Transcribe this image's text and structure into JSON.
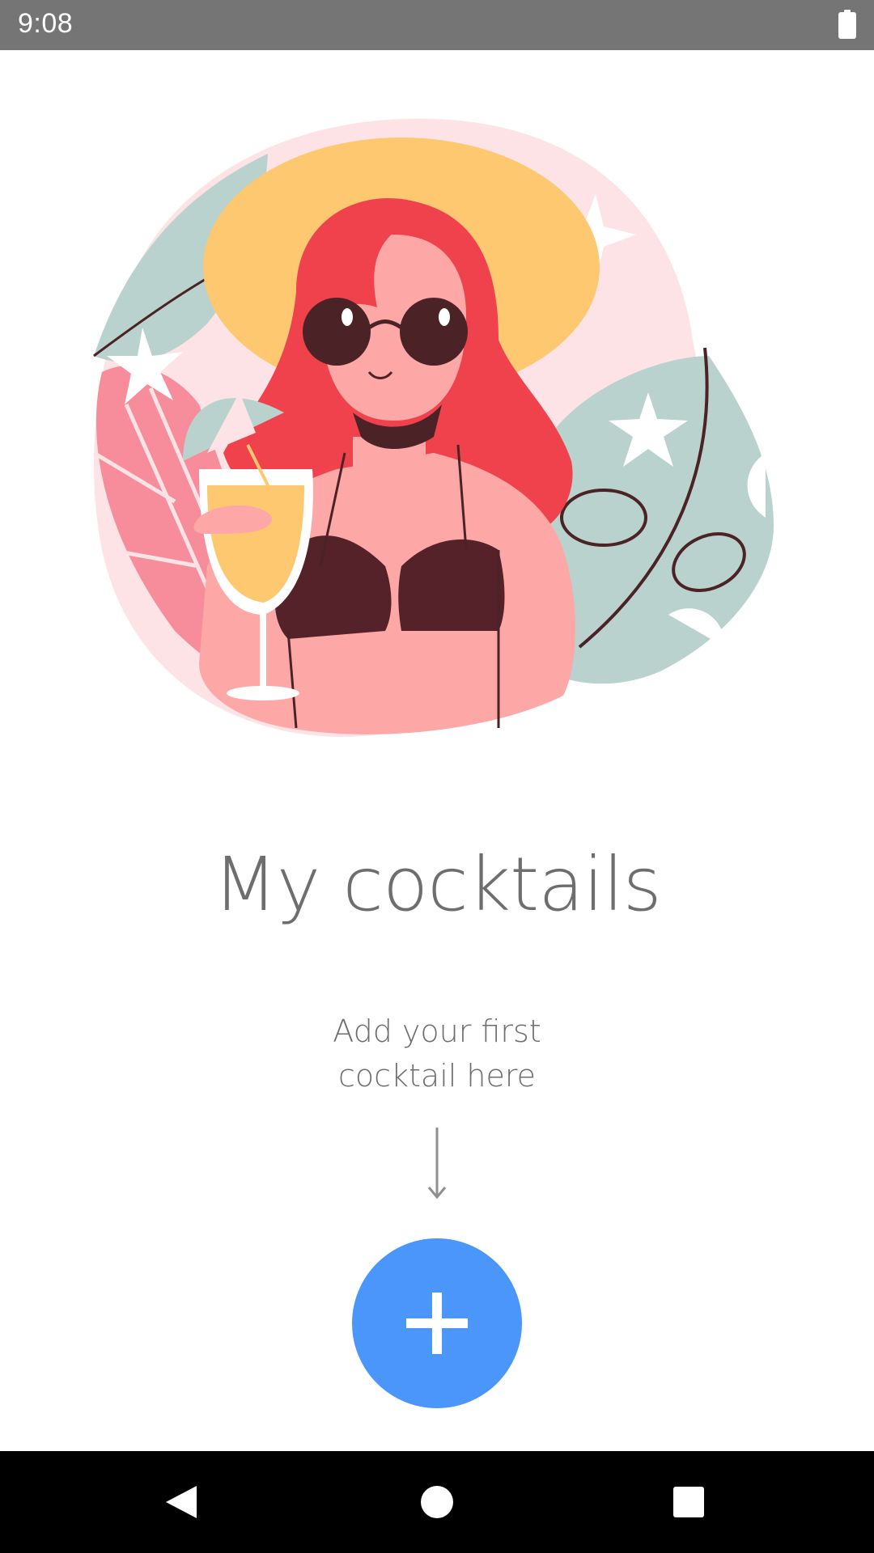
{
  "status_bar": {
    "time": "9:08",
    "battery_icon": "battery-full-icon"
  },
  "hero": {
    "illustration": "woman-with-cocktail-illustration"
  },
  "main": {
    "title": "My cocktails",
    "subtitle_line1": "Add your first",
    "subtitle_line2": "cocktail here",
    "arrow_icon": "arrow-down-icon",
    "add_button_icon": "plus-icon"
  },
  "navigation": {
    "back_icon": "back-triangle-icon",
    "home_icon": "home-circle-icon",
    "recents_icon": "recents-square-icon"
  },
  "colors": {
    "accent": "#4b96fb",
    "status_bar": "#757575",
    "text": "#6e6e6e",
    "nav_bar": "#000000"
  }
}
